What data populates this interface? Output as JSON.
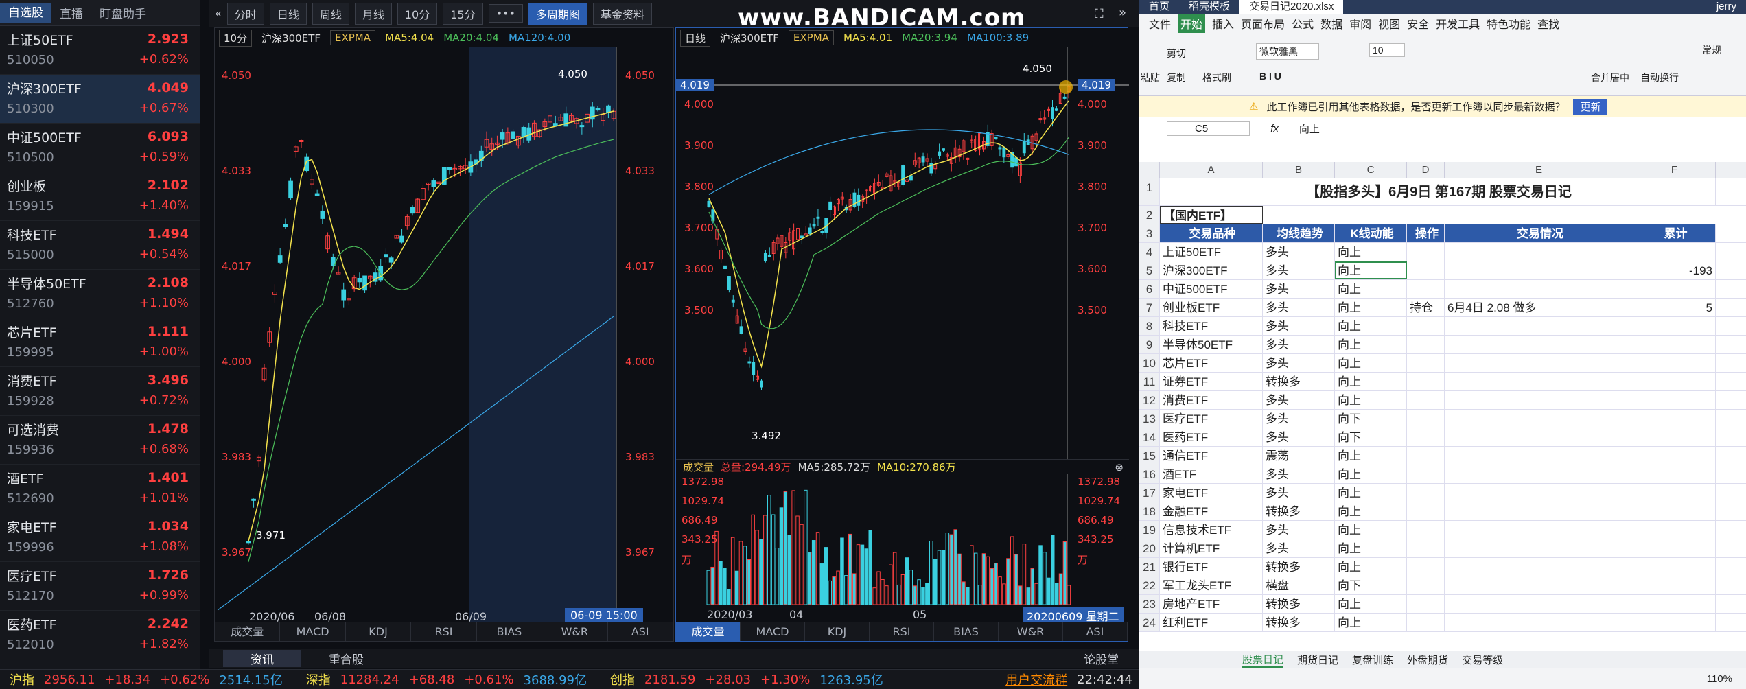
{
  "watchlist": {
    "tabs": [
      "自选股",
      "直播",
      "盯盘助手"
    ],
    "items": [
      {
        "name": "上证50ETF",
        "code": "510050",
        "price": "2.923",
        "pct": "+0.62%"
      },
      {
        "name": "沪深300ETF",
        "code": "510300",
        "price": "4.049",
        "pct": "+0.67%"
      },
      {
        "name": "中证500ETF",
        "code": "510500",
        "price": "6.093",
        "pct": "+0.59%"
      },
      {
        "name": "创业板",
        "code": "159915",
        "price": "2.102",
        "pct": "+1.40%"
      },
      {
        "name": "科技ETF",
        "code": "515000",
        "price": "1.494",
        "pct": "+0.54%"
      },
      {
        "name": "半导体50ETF",
        "code": "512760",
        "price": "2.108",
        "pct": "+1.10%"
      },
      {
        "name": "芯片ETF",
        "code": "159995",
        "price": "1.111",
        "pct": "+1.00%"
      },
      {
        "name": "消费ETF",
        "code": "159928",
        "price": "3.496",
        "pct": "+0.72%"
      },
      {
        "name": "可选消费",
        "code": "159936",
        "price": "1.478",
        "pct": "+0.68%"
      },
      {
        "name": "酒ETF",
        "code": "512690",
        "price": "1.401",
        "pct": "+1.01%"
      },
      {
        "name": "家电ETF",
        "code": "159996",
        "price": "1.034",
        "pct": "+1.08%"
      },
      {
        "name": "医疗ETF",
        "code": "512170",
        "price": "1.726",
        "pct": "+0.99%"
      },
      {
        "name": "医药ETF",
        "code": "512010",
        "price": "2.242",
        "pct": "+1.82%"
      }
    ]
  },
  "toolbar": {
    "items": [
      "分时",
      "日线",
      "周线",
      "月线",
      "10分",
      "15分",
      "•••",
      "多周期图",
      "基金资料"
    ],
    "watermark": "www.BANDICAM.com"
  },
  "left_chart": {
    "period": "10分",
    "symbol": "沪深300ETF",
    "indicator": "EXPMA",
    "ma5": "MA5:4.04",
    "ma20": "MA20:4.04",
    "ma120": "MA120:4.00",
    "yticks": [
      "4.050",
      "4.033",
      "4.017",
      "4.000",
      "3.983",
      "3.967"
    ],
    "xticks": [
      "2020/06",
      "06/08",
      "06/09"
    ],
    "hi": "4.050",
    "lo": "3.971",
    "cursor_time": "06-09 15:00",
    "tabs": [
      "成交量",
      "MACD",
      "KDJ",
      "RSI",
      "BIAS",
      "W&R",
      "ASI"
    ]
  },
  "right_chart": {
    "period": "日线",
    "symbol": "沪深300ETF",
    "indicator": "EXPMA",
    "ma5": "MA5:4.01",
    "ma20": "MA20:3.94",
    "ma100": "MA100:3.89",
    "yticks": [
      "4.000",
      "3.900",
      "3.800",
      "3.700",
      "3.600",
      "3.500"
    ],
    "cursor_price": "4.019",
    "hi": "4.050",
    "lo": "3.492",
    "vol_header": "成交量",
    "vol_total": "总量:294.49万",
    "vol_ma5": "MA5:285.72万",
    "vol_ma10": "MA10:270.86万",
    "vol_ticks": [
      "1372.98",
      "1029.74",
      "686.49",
      "343.25",
      "万"
    ],
    "xticks": [
      "2020/03",
      "04",
      "05"
    ],
    "cursor_date": "20200609 星期二",
    "tabs": [
      "成交量",
      "MACD",
      "KDJ",
      "RSI",
      "BIAS",
      "W&R",
      "ASI"
    ]
  },
  "bottom_tabs": [
    "资讯",
    "重合股",
    "论股堂"
  ],
  "status": {
    "sh": "沪指",
    "sh_v": "2956.11",
    "sh_c": "+18.34",
    "sh_p": "+0.62%",
    "sh_a": "2514.15亿",
    "sz": "深指",
    "sz_v": "11284.24",
    "sz_c": "+68.48",
    "sz_p": "+0.61%",
    "sz_a": "3688.99亿",
    "cy": "创指",
    "cy_v": "2181.59",
    "cy_c": "+28.03",
    "cy_p": "+1.30%",
    "cy_a": "1263.95亿",
    "link": "用户交流群",
    "time": "22:42:44"
  },
  "excel": {
    "tabs": [
      "首页",
      "稻壳模板",
      "交易日记2020.xlsx"
    ],
    "user": "jerry",
    "menu": [
      "文件",
      "开始",
      "插入",
      "页面布局",
      "公式",
      "数据",
      "审阅",
      "视图",
      "安全",
      "开发工具",
      "特色功能",
      "查找"
    ],
    "font": "微软雅黑",
    "size": "10",
    "ribbon": {
      "cut": "剪切",
      "copy": "复制",
      "paste": "粘贴",
      "brush": "格式刷",
      "merge": "合并居中",
      "wrap": "自动换行",
      "general": "常规"
    },
    "notice": "此工作簿已引用其他表格数据，是否更新工作簿以同步最新数据？",
    "notice_btn": "更新",
    "cell_ref": "C5",
    "formula": "向上",
    "cols": [
      "A",
      "B",
      "C",
      "D",
      "E",
      "F"
    ],
    "title": "【股指多头】6月9日 第167期 股票交易日记",
    "section": "【国内ETF】",
    "headers": [
      "交易品种",
      "均线趋势",
      "K线动能",
      "操作",
      "交易情况",
      "累计"
    ],
    "rows": [
      [
        "上证50ETF",
        "多头",
        "向上",
        "",
        "",
        ""
      ],
      [
        "沪深300ETF",
        "多头",
        "向上",
        "",
        "",
        "-193"
      ],
      [
        "中证500ETF",
        "多头",
        "向上",
        "",
        "",
        ""
      ],
      [
        "创业板ETF",
        "多头",
        "向上",
        "持仓",
        "6月4日 2.08 做多",
        "5"
      ],
      [
        "科技ETF",
        "多头",
        "向上",
        "",
        "",
        ""
      ],
      [
        "半导体50ETF",
        "多头",
        "向上",
        "",
        "",
        ""
      ],
      [
        "芯片ETF",
        "多头",
        "向上",
        "",
        "",
        ""
      ],
      [
        "证券ETF",
        "转换多",
        "向上",
        "",
        "",
        ""
      ],
      [
        "消费ETF",
        "多头",
        "向上",
        "",
        "",
        ""
      ],
      [
        "医疗ETF",
        "多头",
        "向下",
        "",
        "",
        ""
      ],
      [
        "医药ETF",
        "多头",
        "向下",
        "",
        "",
        ""
      ],
      [
        "通信ETF",
        "震荡",
        "向上",
        "",
        "",
        ""
      ],
      [
        "酒ETF",
        "多头",
        "向上",
        "",
        "",
        ""
      ],
      [
        "家电ETF",
        "多头",
        "向上",
        "",
        "",
        ""
      ],
      [
        "金融ETF",
        "转换多",
        "向上",
        "",
        "",
        ""
      ],
      [
        "信息技术ETF",
        "多头",
        "向上",
        "",
        "",
        ""
      ],
      [
        "计算机ETF",
        "多头",
        "向上",
        "",
        "",
        ""
      ],
      [
        "银行ETF",
        "转换多",
        "向上",
        "",
        "",
        ""
      ],
      [
        "军工龙头ETF",
        "横盘",
        "向下",
        "",
        "",
        ""
      ],
      [
        "房地产ETF",
        "转换多",
        "向上",
        "",
        "",
        ""
      ],
      [
        "红利ETF",
        "转换多",
        "向上",
        "",
        "",
        ""
      ]
    ],
    "sheets": [
      "股票日记",
      "期货日记",
      "复盘训练",
      "外盘期货",
      "交易等级"
    ],
    "zoom": "110%"
  }
}
